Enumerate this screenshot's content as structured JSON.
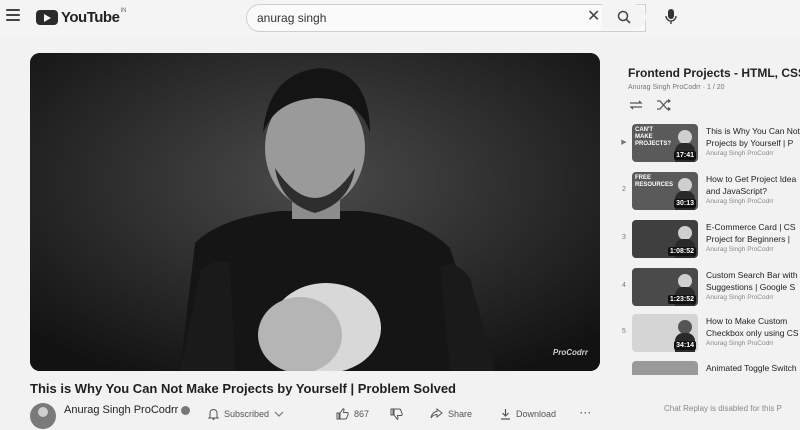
{
  "header": {
    "logo_text": "YouTube",
    "logo_region": "IN",
    "search_value": "anurag singh"
  },
  "video": {
    "title": "This is Why You Can Not Make Projects by Yourself | Problem Solved",
    "watermark": "ProCodrr",
    "channel_name": "Anurag Singh ProCodrr",
    "subscriber_count": "",
    "subscribe_label": "Subscribed",
    "likes": "867",
    "share_label": "Share",
    "download_label": "Download"
  },
  "playlist": {
    "title": "Frontend Projects - HTML, CSS",
    "meta": "Anurag Singh ProCodrr · 1 / 20",
    "items": [
      {
        "index": "▶",
        "thumb_text": "CAN'T MAKE PROJECTS?",
        "duration": "17:41",
        "title_line1": "This is Why You Can Not",
        "title_line2": "Projects by Yourself | P",
        "channel": "Anurag Singh ProCodrr"
      },
      {
        "index": "2",
        "thumb_text": "FREE RESOURCES",
        "duration": "30:13",
        "title_line1": "How to Get Project Idea",
        "title_line2": "and JavaScript?",
        "channel": "Anurag Singh ProCodrr"
      },
      {
        "index": "3",
        "thumb_text": "",
        "duration": "1:08:52",
        "title_line1": "E-Commerce Card | CS",
        "title_line2": "Project for Beginners |",
        "channel": "Anurag Singh ProCodrr"
      },
      {
        "index": "4",
        "thumb_text": "",
        "duration": "1:23:52",
        "title_line1": "Custom Search Bar with",
        "title_line2": "Suggestions | Google S",
        "channel": "Anurag Singh ProCodrr"
      },
      {
        "index": "5",
        "thumb_text": "",
        "duration": "34:14",
        "title_line1": "How to Make Custom",
        "title_line2": "Checkbox only using CS",
        "channel": "Anurag Singh ProCodrr"
      },
      {
        "index": "6",
        "thumb_text": "",
        "duration": "",
        "title_line1": "Animated Toggle Switch",
        "title_line2": "",
        "channel": ""
      }
    ],
    "chat_note": "Chat Replay is disabled for this P"
  }
}
